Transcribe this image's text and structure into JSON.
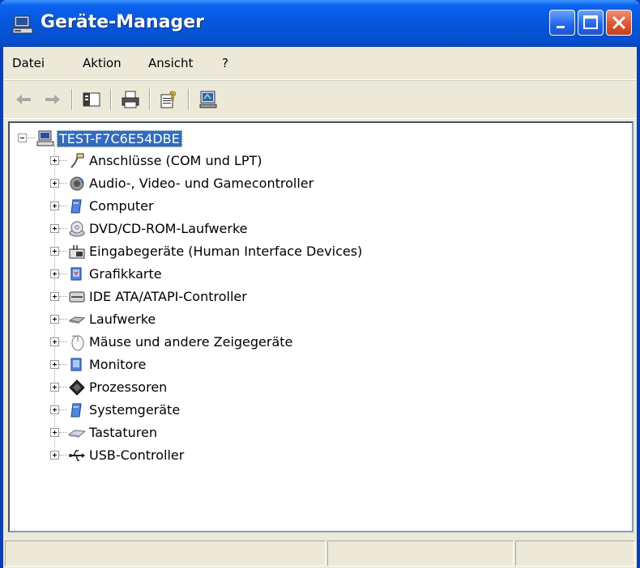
{
  "window": {
    "title": "Geräte-Manager",
    "title_bar_color": "#0a62f0",
    "close_button_color": "#e0502a"
  },
  "menu": {
    "items": [
      {
        "label": "Datei"
      },
      {
        "label": "Aktion"
      },
      {
        "label": "Ansicht"
      },
      {
        "label": "?"
      }
    ]
  },
  "toolbar": {
    "buttons": [
      {
        "icon": "back-arrow-icon"
      },
      {
        "icon": "forward-arrow-icon"
      },
      {
        "icon": "show-hide-console-tree-icon"
      },
      {
        "icon": "printer-icon"
      },
      {
        "icon": "help-properties-icon"
      },
      {
        "icon": "scan-hardware-icon"
      }
    ]
  },
  "tree": {
    "root": {
      "label": "TEST-F7C6E54DBE",
      "icon": "computer-icon",
      "selected": true,
      "expanded": true
    },
    "children": [
      {
        "label": "Anschlüsse (COM und LPT)",
        "icon": "port-icon"
      },
      {
        "label": "Audio-, Video- und Gamecontroller",
        "icon": "speaker-icon"
      },
      {
        "label": "Computer",
        "icon": "computer-device-icon"
      },
      {
        "label": "DVD/CD-ROM-Laufwerke",
        "icon": "cd-drive-icon"
      },
      {
        "label": "Eingabegeräte (Human Interface Devices)",
        "icon": "hid-icon"
      },
      {
        "label": "Grafikkarte",
        "icon": "display-adapter-icon"
      },
      {
        "label": "IDE ATA/ATAPI-Controller",
        "icon": "ide-controller-icon"
      },
      {
        "label": "Laufwerke",
        "icon": "disk-drive-icon"
      },
      {
        "label": "Mäuse und andere Zeigegeräte",
        "icon": "mouse-icon"
      },
      {
        "label": "Monitore",
        "icon": "monitor-icon"
      },
      {
        "label": "Prozessoren",
        "icon": "processor-icon"
      },
      {
        "label": "Systemgeräte",
        "icon": "system-devices-icon"
      },
      {
        "label": "Tastaturen",
        "icon": "keyboard-icon"
      },
      {
        "label": "USB-Controller",
        "icon": "usb-icon"
      }
    ]
  },
  "colors": {
    "selection": "#316ac5",
    "chrome": "#ece9d8"
  }
}
